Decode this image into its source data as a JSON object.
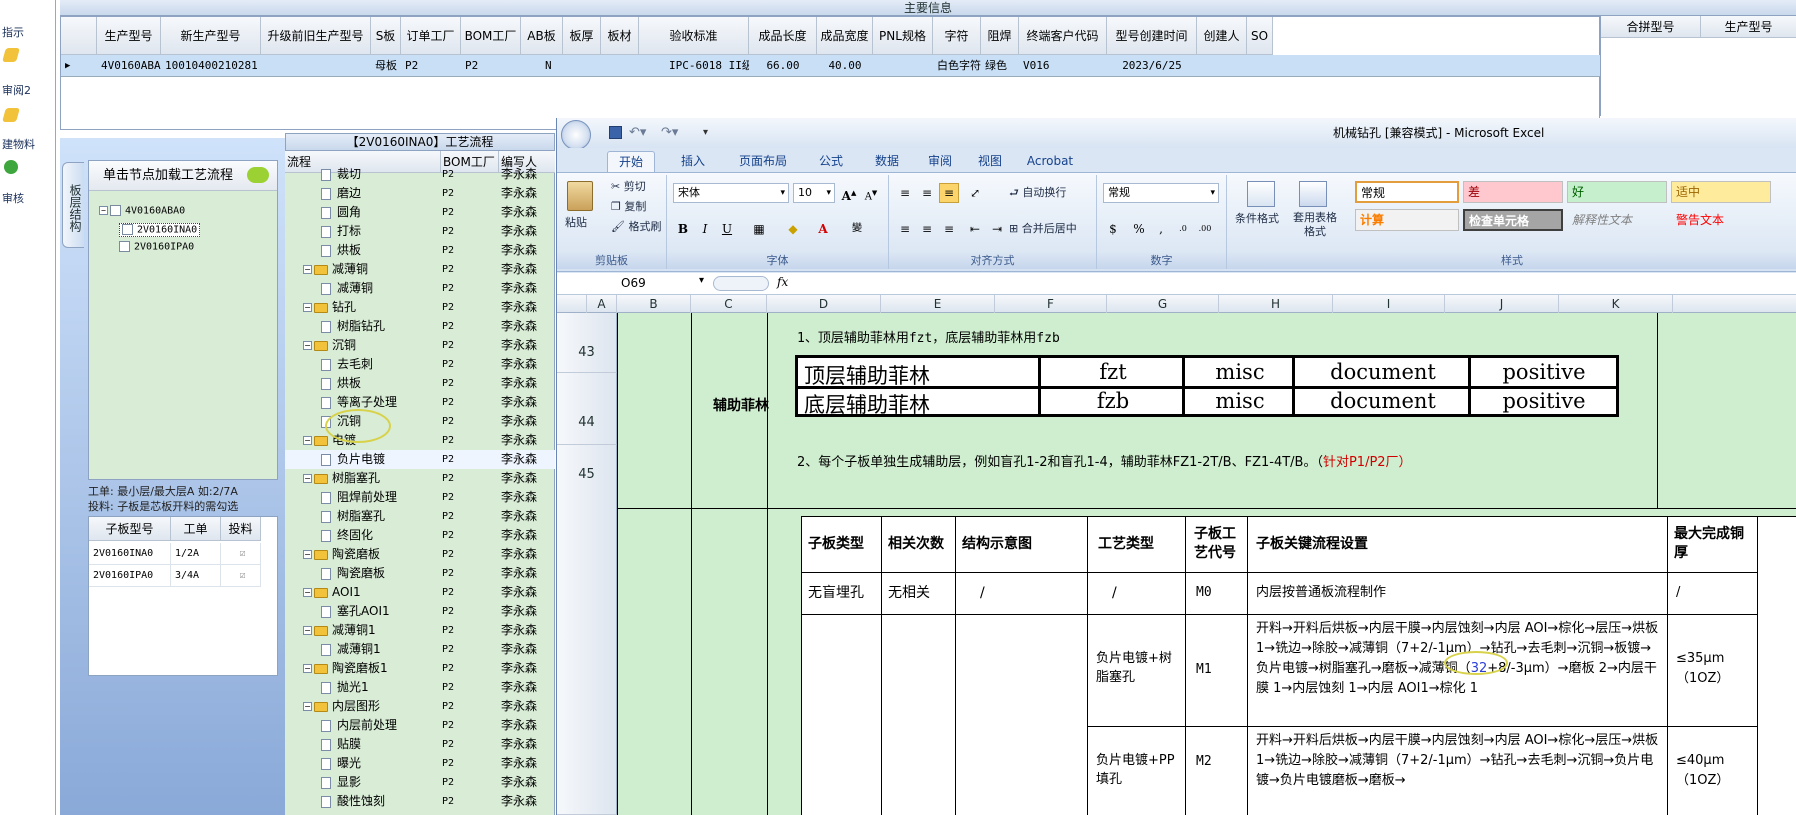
{
  "left_strip": {
    "items": [
      "指示",
      "审阅2",
      "建物料",
      "审核"
    ]
  },
  "main_info": {
    "title": "主要信息",
    "headers": [
      "生产型号",
      "新生产型号",
      "升级前旧生产型号",
      "S板",
      "订单工厂",
      "BOM工厂",
      "AB板",
      "板厚",
      "板材",
      "验收标准",
      "成品长度",
      "成品宽度",
      "PNL规格",
      "字符",
      "阻焊",
      "终端客户代码",
      "型号创建时间",
      "创建人",
      "SO"
    ],
    "row": [
      "4V0160ABA0",
      "10010400210281",
      "",
      "母板",
      "P2",
      "P2",
      "N",
      "",
      "",
      "IPC-6018 II级",
      "66.00",
      "40.00",
      "",
      "白色字符",
      "绿色",
      "V016",
      "2023/6/25",
      "",
      ""
    ],
    "right_headers": [
      "合拼型号",
      "生产型号"
    ]
  },
  "left_panel": {
    "tab": "板层结构",
    "header": "单击节点加载工艺流程",
    "tree": {
      "root": "4V0160ABA0",
      "children": [
        "2V0160INA0",
        "2V0160IPA0"
      ]
    },
    "info_line1": "工单: 最小层/最大层A 如:2/7A",
    "info_line2": "投料: 子板是芯板开料的需勾选",
    "grid_headers": [
      "子板型号",
      "工单",
      "投料"
    ],
    "grid_rows": [
      {
        "model": "2V0160INA0",
        "order": "1/2A"
      },
      {
        "model": "2V0160IPA0",
        "order": "3/4A"
      }
    ]
  },
  "process": {
    "title": "【2V0160INA0】工艺流程",
    "headers": [
      "流程",
      "BOM工厂",
      "编写人"
    ],
    "rows": [
      {
        "level": 2,
        "name": "裁切",
        "bom": "P2",
        "author": "李永森"
      },
      {
        "level": 2,
        "name": "磨边",
        "bom": "P2",
        "author": "李永森"
      },
      {
        "level": 2,
        "name": "圆角",
        "bom": "P2",
        "author": "李永森"
      },
      {
        "level": 2,
        "name": "打标",
        "bom": "P2",
        "author": "李永森"
      },
      {
        "level": 2,
        "name": "烘板",
        "bom": "P2",
        "author": "李永森"
      },
      {
        "level": 1,
        "name": "减薄铜",
        "bom": "P2",
        "author": "李永森"
      },
      {
        "level": 2,
        "name": "减薄铜",
        "bom": "P2",
        "author": "李永森"
      },
      {
        "level": 1,
        "name": "钻孔",
        "bom": "P2",
        "author": "李永森"
      },
      {
        "level": 2,
        "name": "树脂钻孔",
        "bom": "P2",
        "author": "李永森"
      },
      {
        "level": 1,
        "name": "沉铜",
        "bom": "P2",
        "author": "李永森"
      },
      {
        "level": 2,
        "name": "去毛刺",
        "bom": "P2",
        "author": "李永森"
      },
      {
        "level": 2,
        "name": "烘板",
        "bom": "P2",
        "author": "李永森"
      },
      {
        "level": 2,
        "name": "等离子处理",
        "bom": "P2",
        "author": "李永森"
      },
      {
        "level": 2,
        "name": "沉铜",
        "bom": "P2",
        "author": "李永森"
      },
      {
        "level": 1,
        "name": "电镀",
        "bom": "P2",
        "author": "李永森"
      },
      {
        "level": 2,
        "name": "负片电镀",
        "bom": "P2",
        "author": "李永森"
      },
      {
        "level": 1,
        "name": "树脂塞孔",
        "bom": "P2",
        "author": "李永森"
      },
      {
        "level": 2,
        "name": "阻焊前处理",
        "bom": "P2",
        "author": "李永森"
      },
      {
        "level": 2,
        "name": "树脂塞孔",
        "bom": "P2",
        "author": "李永森"
      },
      {
        "level": 2,
        "name": "终固化",
        "bom": "P2",
        "author": "李永森"
      },
      {
        "level": 1,
        "name": "陶瓷磨板",
        "bom": "P2",
        "author": "李永森"
      },
      {
        "level": 2,
        "name": "陶瓷磨板",
        "bom": "P2",
        "author": "李永森"
      },
      {
        "level": 1,
        "name": "AOI1",
        "bom": "P2",
        "author": "李永森"
      },
      {
        "level": 2,
        "name": "塞孔AOI1",
        "bom": "P2",
        "author": "李永森"
      },
      {
        "level": 1,
        "name": "减薄铜1",
        "bom": "P2",
        "author": "李永森"
      },
      {
        "level": 2,
        "name": "减薄铜1",
        "bom": "P2",
        "author": "李永森"
      },
      {
        "level": 1,
        "name": "陶瓷磨板1",
        "bom": "P2",
        "author": "李永森"
      },
      {
        "level": 2,
        "name": "抛光1",
        "bom": "P2",
        "author": "李永森"
      },
      {
        "level": 1,
        "name": "内层图形",
        "bom": "P2",
        "author": "李永森"
      },
      {
        "level": 2,
        "name": "内层前处理",
        "bom": "P2",
        "author": "李永森"
      },
      {
        "level": 2,
        "name": "贴膜",
        "bom": "P2",
        "author": "李永森"
      },
      {
        "level": 2,
        "name": "曝光",
        "bom": "P2",
        "author": "李永森"
      },
      {
        "level": 2,
        "name": "显影",
        "bom": "P2",
        "author": "李永森"
      },
      {
        "level": 2,
        "name": "酸性蚀刻",
        "bom": "P2",
        "author": "李永森"
      }
    ]
  },
  "excel": {
    "title": "机械钻孔 [兼容模式] - Microsoft Excel",
    "tabs": [
      "开始",
      "插入",
      "页面布局",
      "公式",
      "数据",
      "审阅",
      "视图",
      "Acrobat"
    ],
    "clipboard": {
      "paste": "粘贴",
      "cut": "剪切",
      "copy": "复制",
      "format_painter": "格式刷",
      "label": "剪贴板"
    },
    "font": {
      "name": "宋体",
      "size": "10",
      "label": "字体"
    },
    "align": {
      "wrap": "自动换行",
      "merge": "合并后居中",
      "label": "对齐方式"
    },
    "number": {
      "format": "常规",
      "label": "数字"
    },
    "styles": {
      "cond": "条件格式",
      "table": "套用表格格式",
      "label": "样式",
      "cells": [
        "常规",
        "差",
        "好",
        "适中",
        "计算",
        "检查单元格",
        "解释性文本",
        "警告文本"
      ]
    },
    "name_box": "O69",
    "fx": "fx",
    "columns": [
      "A",
      "B",
      "C",
      "D",
      "E",
      "F",
      "G",
      "H",
      "I",
      "J",
      "K"
    ],
    "rows": [
      "43",
      "44",
      "45"
    ],
    "section_label": "辅助菲林",
    "line1": "1、顶层辅助菲林用fzt，底层辅助菲林用fzb",
    "film_table": [
      [
        "顶层辅助菲林",
        "fzt",
        "misc",
        "document",
        "positive"
      ],
      [
        "底层辅助菲林",
        "fzb",
        "misc",
        "document",
        "positive"
      ]
    ],
    "line2": "2、每个子板单独生成辅助层，例如盲孔1-2和盲孔1-4，辅助菲林FZ1-2T/B、FZ1-4T/B。（",
    "line2_red": "针对P1/P2厂）",
    "table_headers": [
      "子板类型",
      "相关次数",
      "结构示意图",
      "工艺类型",
      "子板工艺代号",
      "子板关键流程设置",
      "最大完成铜厚"
    ],
    "table_rows": [
      {
        "type": "无盲埋孔",
        "count": "无相关",
        "diagram": "/",
        "process": "/",
        "code": "M0",
        "flow": "内层按普通板流程制作",
        "copper": "/"
      },
      {
        "type": "",
        "count": "",
        "diagram": "",
        "process": "负片电镀+树脂塞孔",
        "code": "M1",
        "flow_a": "开料→开料后烘板→内层干膜→内层蚀刻→内层 AOI→棕化→层压→烘板 1→铣边→除胶→减薄铜（7+2/-1μm）→钻孔→去毛刺→沉铜→板镀→负片电镀→树脂塞孔→磨板→减薄铜（",
        "flow_blue": "32",
        "flow_b": "+8/-3μm）→磨板 2→内层干膜 1→内层蚀刻 1→内层 AOI1→棕化 1",
        "copper": "≤35μm（1OZ）"
      },
      {
        "type": "",
        "count": "",
        "diagram": "",
        "process": "负片电镀+PP 填孔",
        "code": "M2",
        "flow": "开料→开料后烘板→内层干膜→内层蚀刻→内层 AOI→棕化→层压→烘板 1→铣边→除胶→减薄铜（7+2/-1μm）→钻孔→去毛刺→沉铜→负片电镀→负片电镀磨板→磨板→",
        "copper": "≤40μm（1OZ）"
      }
    ]
  }
}
